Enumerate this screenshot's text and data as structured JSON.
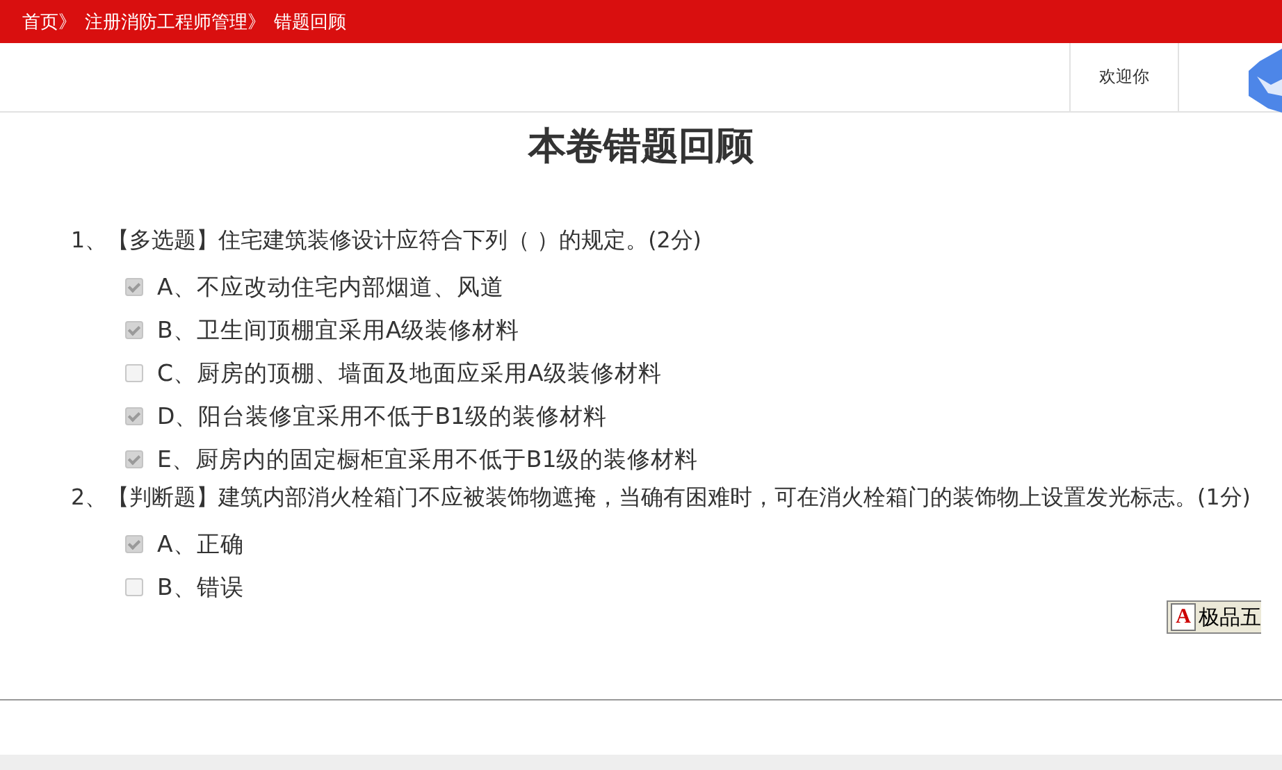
{
  "breadcrumb": [
    "首页》",
    "注册消防工程师管理》",
    "错题回顾"
  ],
  "header": {
    "welcome": "欢迎你"
  },
  "title": "本卷错题回顾",
  "questions": [
    {
      "text": "1、【多选题】住宅建筑装修设计应符合下列（ ）的规定。(2分)",
      "options": [
        {
          "label": "A、不应改动住宅内部烟道、风道",
          "checked": true
        },
        {
          "label": "B、卫生间顶棚宜采用A级装修材料",
          "checked": true
        },
        {
          "label": "C、厨房的顶棚、墙面及地面应采用A级装修材料",
          "checked": false
        },
        {
          "label": "D、阳台装修宜采用不低于B1级的装修材料",
          "checked": true
        },
        {
          "label": "E、厨房内的固定橱柜宜采用不低于B1级的装修材料",
          "checked": true
        }
      ]
    },
    {
      "text": "2、【判断题】建筑内部消火栓箱门不应被装饰物遮掩，当确有困难时，可在消火栓箱门的装饰物上设置发光标志。(1分)",
      "options": [
        {
          "label": "A、正确",
          "checked": true
        },
        {
          "label": "B、错误",
          "checked": false
        }
      ]
    }
  ],
  "ime_bar": {
    "icon_letter": "A",
    "label": "极品五"
  }
}
